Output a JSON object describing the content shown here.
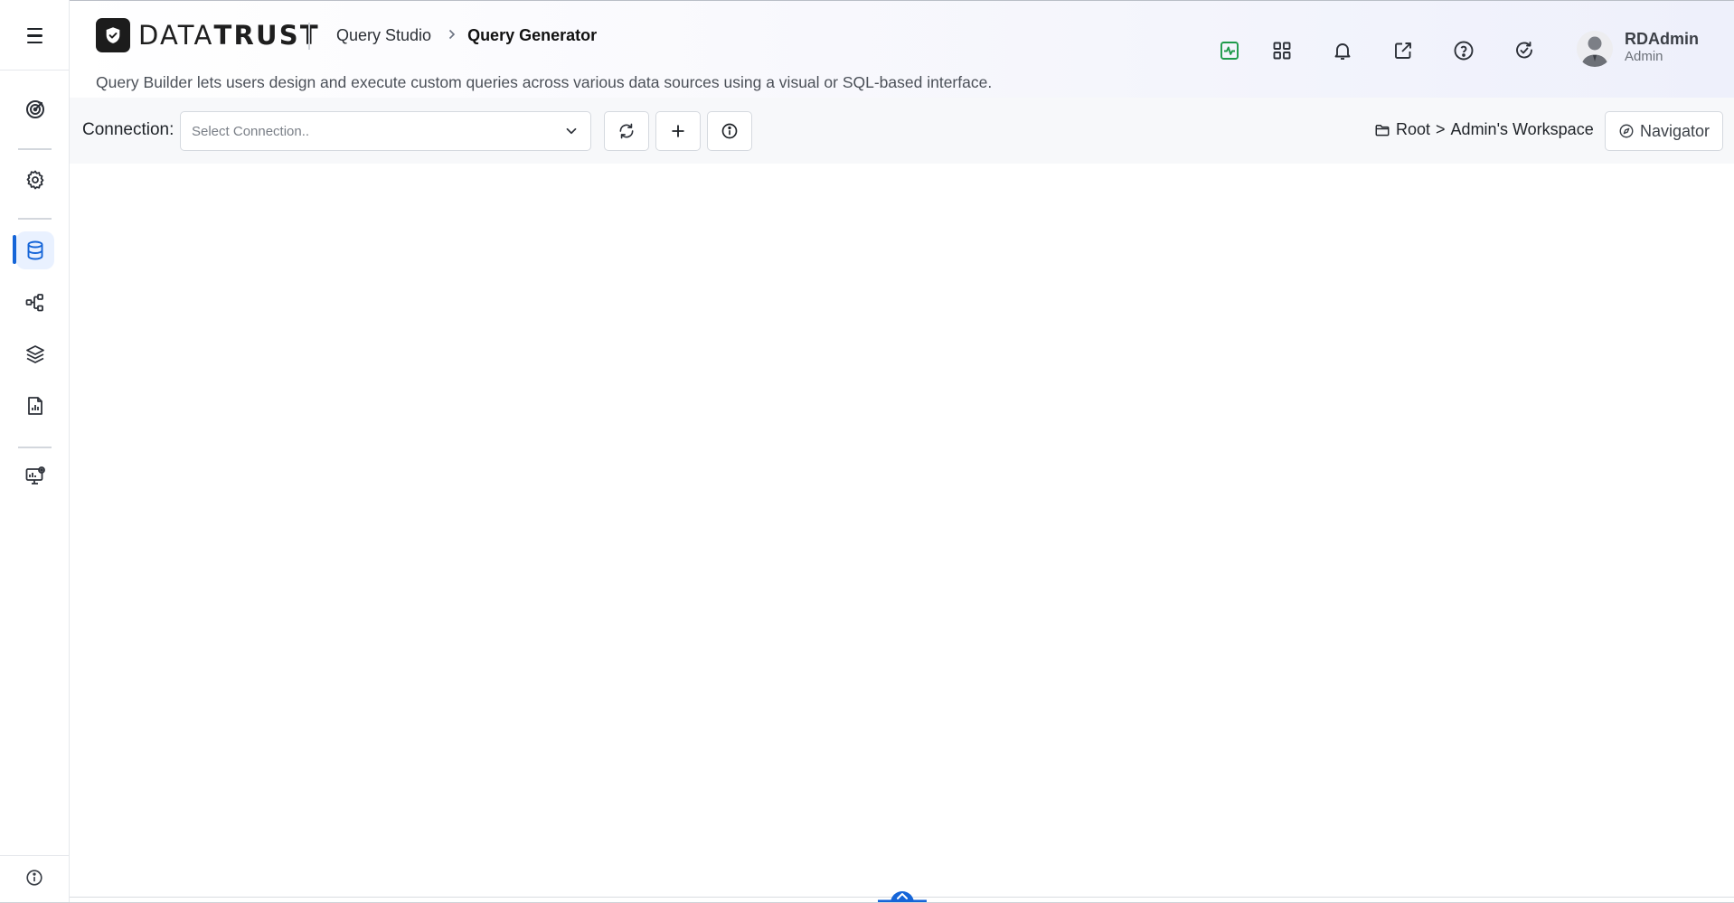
{
  "app": {
    "logo_text_light": "DATA",
    "logo_text_bold": "TRUST"
  },
  "breadcrumb": {
    "parent": "Query Studio",
    "current": "Query Generator"
  },
  "page": {
    "description": "Query Builder lets users design and execute custom queries across various data sources using a visual or SQL-based interface."
  },
  "user": {
    "name": "RDAdmin",
    "role": "Admin"
  },
  "toolbar": {
    "connection_label": "Connection:",
    "connection_placeholder": "Select Connection..",
    "workspace_root": "Root",
    "workspace_separator": ">",
    "workspace_name": "Admin's Workspace",
    "navigator_label": "Navigator"
  },
  "sidebar": {
    "items": [
      {
        "icon": "target-icon"
      },
      {
        "icon": "gear-icon"
      },
      {
        "icon": "database-icon",
        "active": true
      },
      {
        "icon": "lineage-icon"
      },
      {
        "icon": "layers-icon"
      },
      {
        "icon": "report-icon"
      },
      {
        "icon": "monitor-settings-icon"
      }
    ]
  },
  "colors": {
    "accent": "#1565d8",
    "active_bg": "#e9f1ff",
    "activity_icon": "#1e9a4a"
  }
}
